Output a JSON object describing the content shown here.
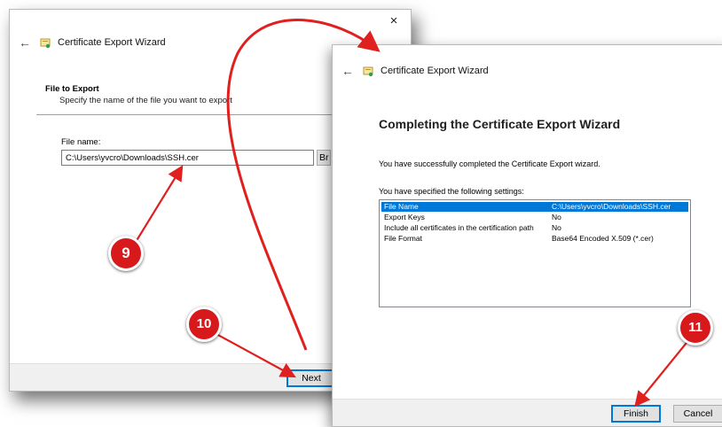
{
  "back_window": {
    "close_glyph": "×",
    "title": "Certificate Export Wizard",
    "section_title": "File to Export",
    "section_subtitle": "Specify the name of the file you want to export",
    "filename_label": "File name:",
    "filename_value": "C:\\Users\\yvcro\\Downloads\\SSH.cer",
    "browse_label": "Br",
    "next_label": "Next"
  },
  "front_window": {
    "close_glyph": "×",
    "title": "Certificate Export Wizard",
    "heading": "Completing the Certificate Export Wizard",
    "success_text": "You have successfully completed the Certificate Export wizard.",
    "settings_intro": "You have specified the following settings:",
    "settings": [
      {
        "key": "File Name",
        "value": "C:\\Users\\yvcro\\Downloads\\SSH.cer",
        "selected": true
      },
      {
        "key": "Export Keys",
        "value": "No"
      },
      {
        "key": "Include all certificates in the certification path",
        "value": "No"
      },
      {
        "key": "File Format",
        "value": "Base64 Encoded X.509 (*.cer)"
      }
    ],
    "finish_label": "Finish",
    "cancel_label": "Cancel"
  },
  "annotations": {
    "step_9": "9",
    "step_10": "10",
    "step_11": "11",
    "badge_color": "#d7191c",
    "arrow_color": "#e0201f"
  },
  "icons": {
    "back": "back-arrow-icon",
    "certificate": "certificate-icon",
    "close": "close-icon"
  }
}
